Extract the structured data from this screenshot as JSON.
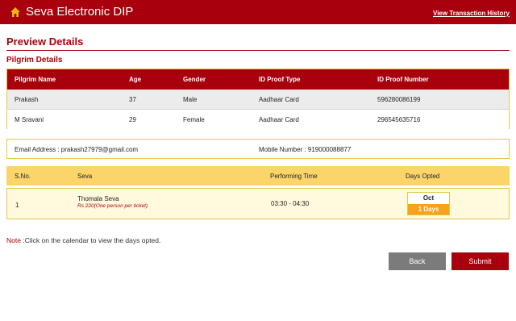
{
  "header": {
    "app_title": "Seva Electronic DIP",
    "history_link": "View Transaction History",
    "icon": "home-icon"
  },
  "page_title": "Preview Details",
  "pilgrim_section_title": "Pilgrim Details",
  "pilgrim_table": {
    "headers": [
      "Pilgrim Name",
      "Age",
      "Gender",
      "ID Proof Type",
      "ID Proof Number"
    ],
    "rows": [
      [
        "Prakash",
        "37",
        "Male",
        "Aadhaar Card",
        "596280086199"
      ],
      [
        "M Sravani",
        "29",
        "Female",
        "Aadhaar Card",
        "296545635716"
      ]
    ]
  },
  "contact": {
    "email": "Email Address : prakash27979@gmail.com",
    "mobile": "Mobile Number : 919000088877"
  },
  "seva_table": {
    "headers": [
      "S.No.",
      "Seva",
      "Performing Time",
      "Days Opted"
    ],
    "rows": [
      {
        "sno": "1",
        "seva_name": "Thomala Seva",
        "seva_price": "Rs 220(One person per ticket)",
        "time": "03:30 - 04:30",
        "day_month": "Oct",
        "day_count": "1 Days"
      }
    ]
  },
  "note": {
    "label": "Note",
    "text": " :Click on the calendar to view the days opted."
  },
  "buttons": {
    "back": "Back",
    "submit": "Submit"
  },
  "colors": {
    "primary": "#a8000c",
    "header_yellow": "#fbd56a",
    "accent_orange": "#f7a21a",
    "back_gray": "#7b7b7b"
  }
}
